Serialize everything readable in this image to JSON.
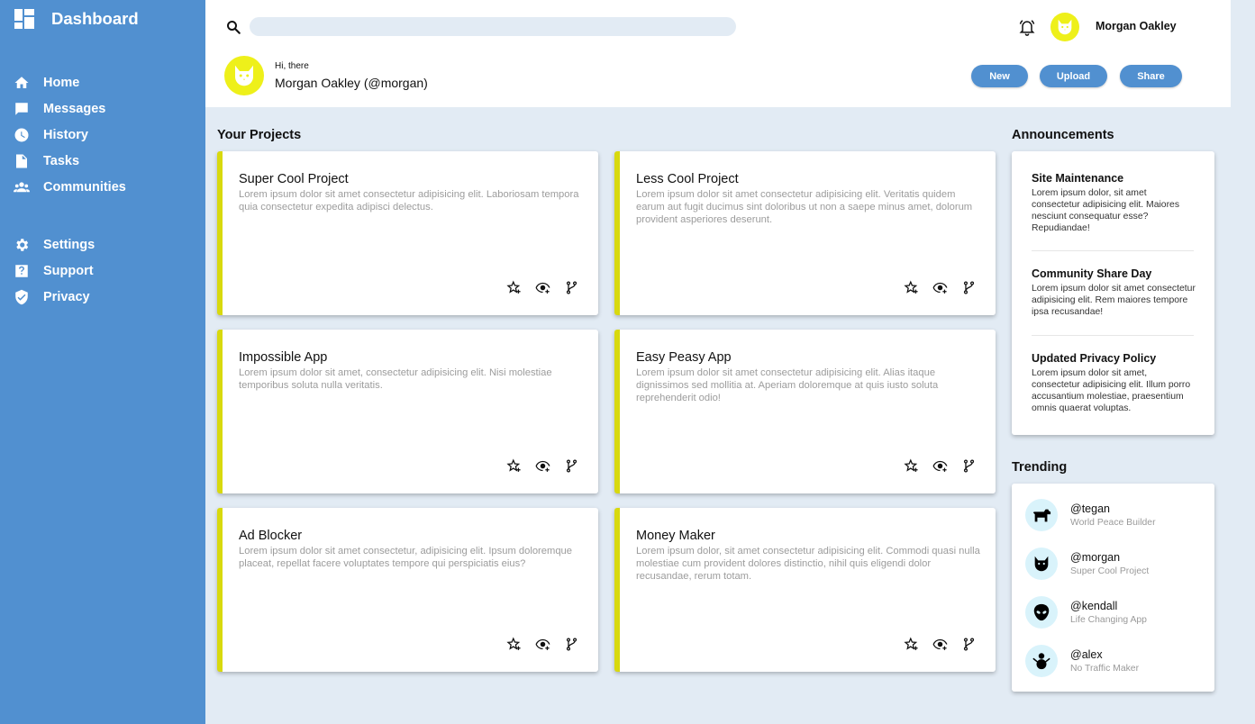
{
  "app": {
    "title": "Dashboard"
  },
  "colors": {
    "sidebar": "#5190d0",
    "accent": "#d8d90e",
    "avatar": "#eef01a",
    "background": "#e2ebf4"
  },
  "sidebar": {
    "items": [
      {
        "label": "Home",
        "icon": "home-icon"
      },
      {
        "label": "Messages",
        "icon": "message-icon"
      },
      {
        "label": "History",
        "icon": "clock-icon"
      },
      {
        "label": "Tasks",
        "icon": "file-icon"
      },
      {
        "label": "Communities",
        "icon": "people-icon"
      }
    ],
    "secondary": [
      {
        "label": "Settings",
        "icon": "gear-icon"
      },
      {
        "label": "Support",
        "icon": "help-icon"
      },
      {
        "label": "Privacy",
        "icon": "shield-icon"
      }
    ]
  },
  "header": {
    "search": {
      "placeholder": "",
      "value": ""
    },
    "user": {
      "name": "Morgan Oakley"
    },
    "greeting": "Hi, there",
    "full_name": "Morgan Oakley (@morgan)",
    "buttons": {
      "new": "New",
      "upload": "Upload",
      "share": "Share"
    }
  },
  "projects": {
    "title": "Your Projects",
    "items": [
      {
        "title": "Super Cool Project",
        "desc": "Lorem ipsum dolor sit amet consectetur adipisicing elit. Laboriosam tempora quia consectetur expedita adipisci delectus."
      },
      {
        "title": "Less Cool Project",
        "desc": "Lorem ipsum dolor sit amet consectetur adipisicing elit. Veritatis quidem earum aut fugit ducimus sint doloribus ut non a saepe minus amet, dolorum provident asperiores deserunt."
      },
      {
        "title": "Impossible App",
        "desc": "Lorem ipsum dolor sit amet, consectetur adipisicing elit. Nisi molestiae temporibus soluta nulla veritatis."
      },
      {
        "title": "Easy Peasy App",
        "desc": "Lorem ipsum dolor sit amet consectetur adipisicing elit. Alias itaque dignissimos sed mollitia at. Aperiam doloremque at quis iusto soluta reprehenderit odio!"
      },
      {
        "title": "Ad Blocker",
        "desc": "Lorem ipsum dolor sit amet consectetur, adipisicing elit. Ipsum doloremque placeat, repellat facere voluptates tempore qui perspiciatis eius?"
      },
      {
        "title": "Money Maker",
        "desc": "Lorem ipsum dolor, sit amet consectetur adipisicing elit. Commodi quasi nulla molestiae cum provident dolores distinctio, nihil quis eligendi dolor recusandae, rerum totam."
      }
    ]
  },
  "announcements": {
    "title": "Announcements",
    "items": [
      {
        "title": "Site Maintenance",
        "body": "Lorem ipsum dolor, sit amet consectetur adipisicing elit. Maiores nesciunt consequatur esse? Repudiandae!"
      },
      {
        "title": "Community Share Day",
        "body": "Lorem ipsum dolor sit amet consectetur adipisicing elit. Rem maiores tempore ipsa recusandae!"
      },
      {
        "title": "Updated Privacy Policy",
        "body": "Lorem ipsum dolor sit amet, consectetur adipisicing elit. Illum porro accusantium molestiae, praesentium omnis quaerat voluptas."
      }
    ]
  },
  "trending": {
    "title": "Trending",
    "items": [
      {
        "handle": "@tegan",
        "project": "World Peace Builder",
        "icon": "dog-icon"
      },
      {
        "handle": "@morgan",
        "project": "Super Cool Project",
        "icon": "cat-icon"
      },
      {
        "handle": "@kendall",
        "project": "Life Changing App",
        "icon": "alien-icon"
      },
      {
        "handle": "@alex",
        "project": "No Traffic Maker",
        "icon": "snowman-icon"
      }
    ]
  }
}
